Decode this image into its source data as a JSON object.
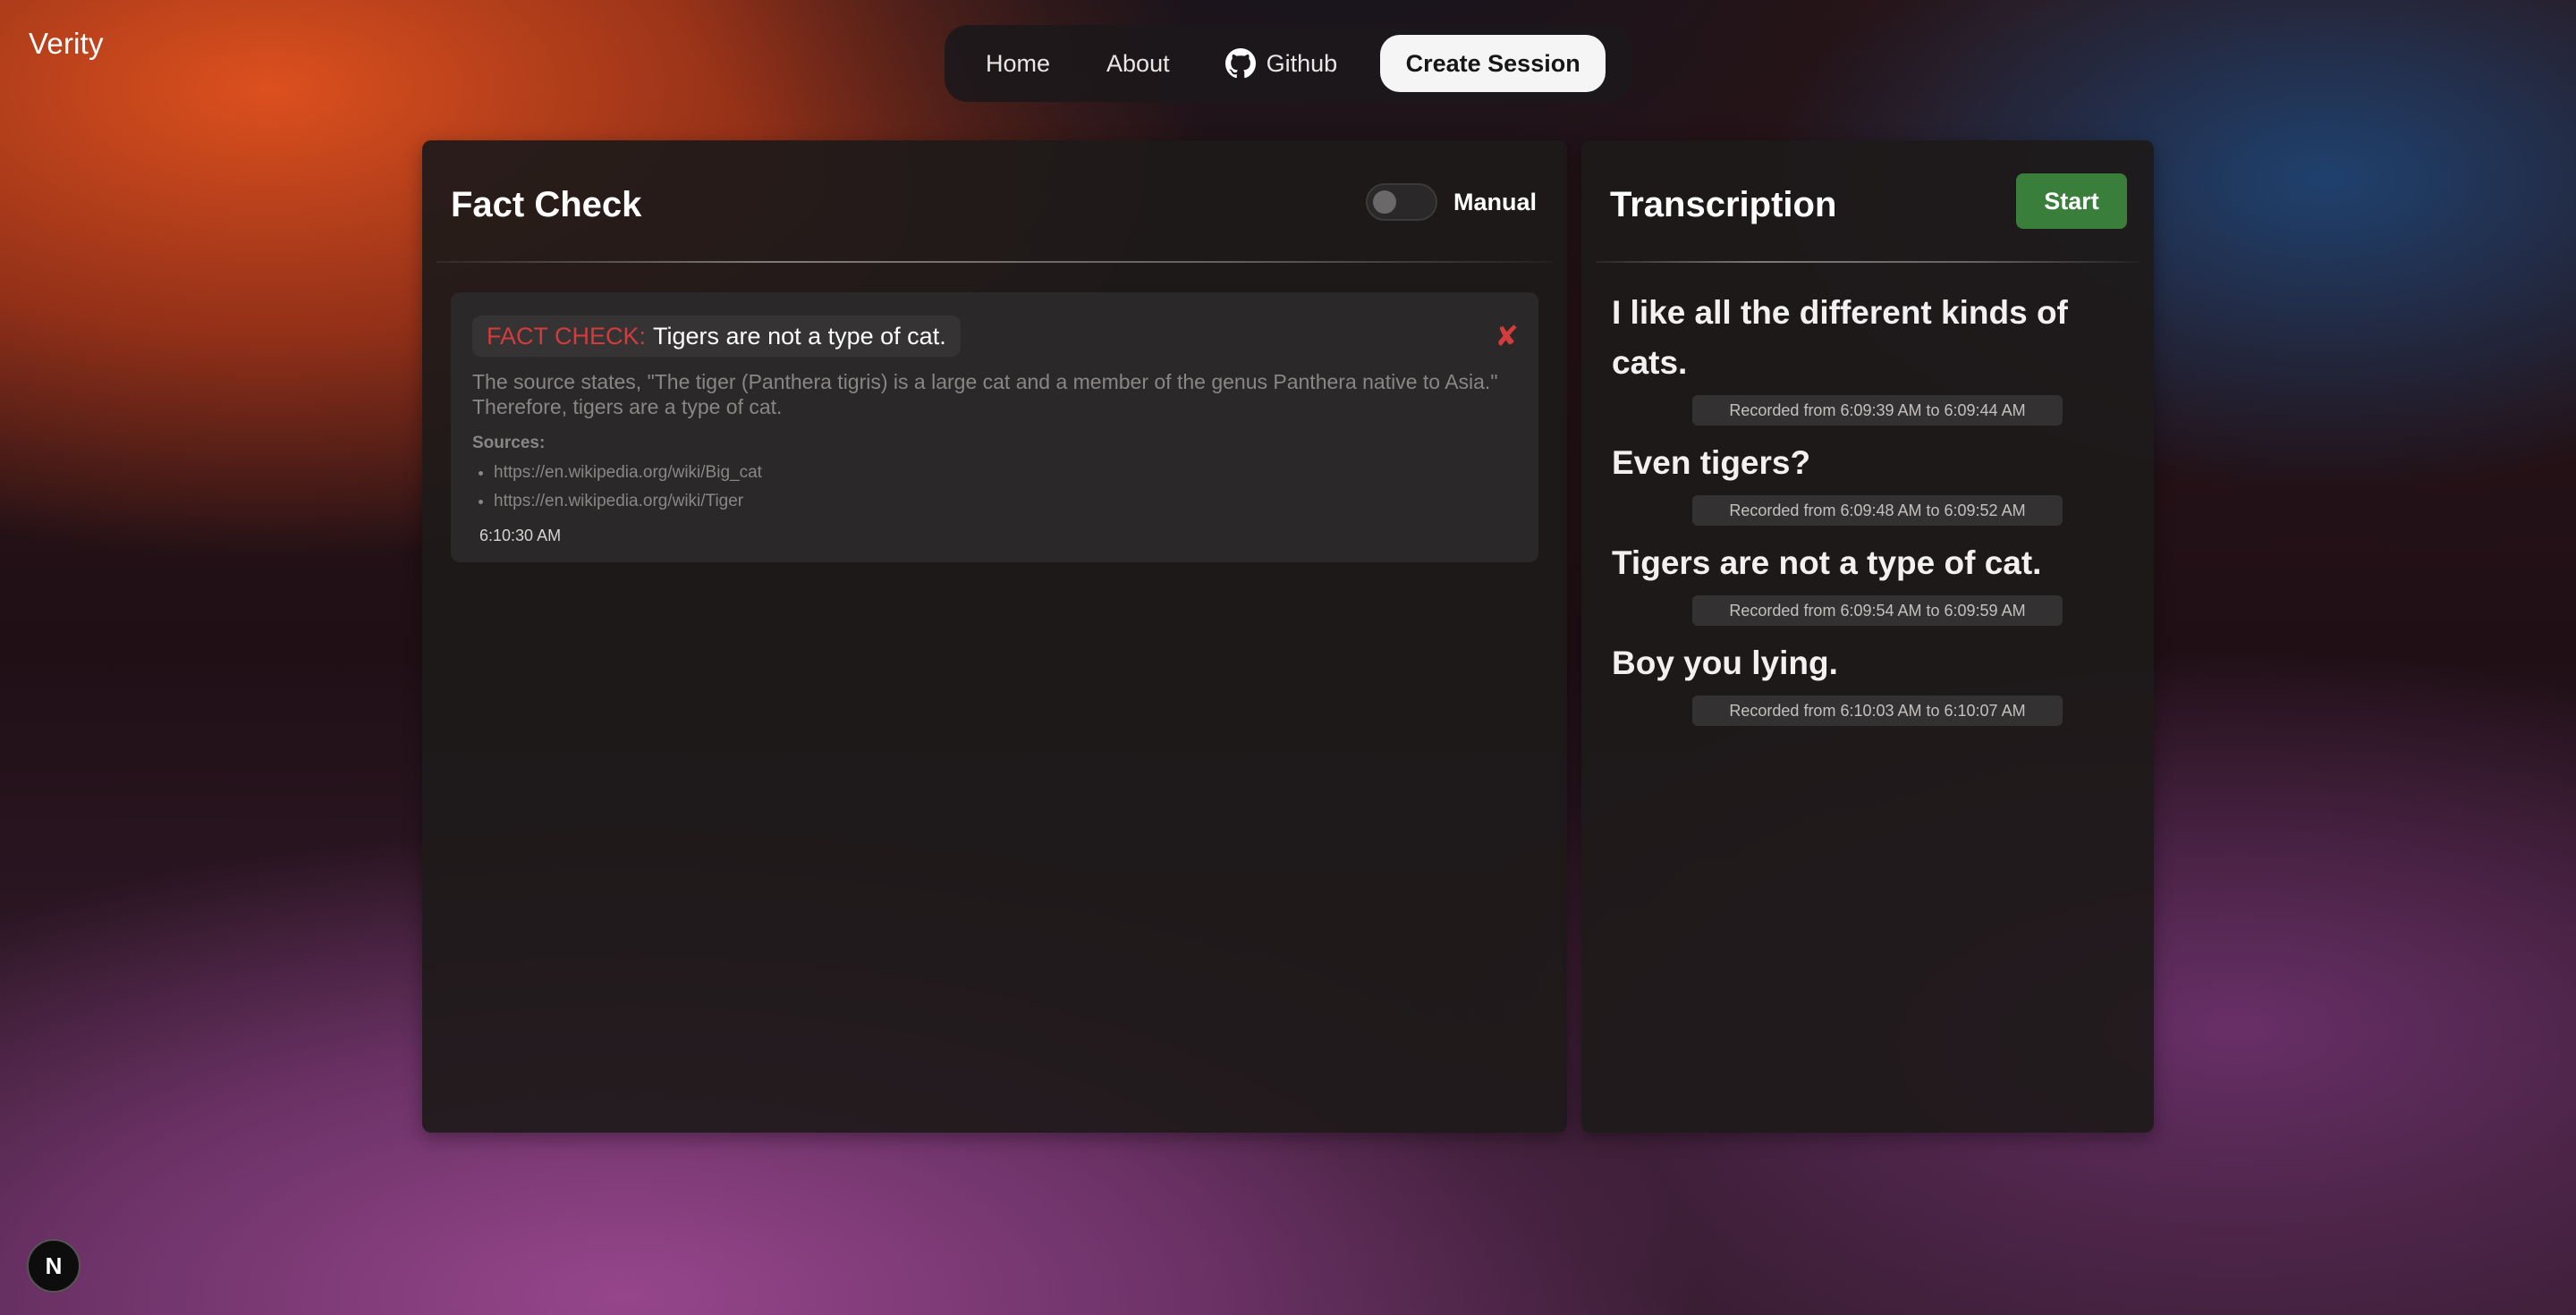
{
  "brand": "Verity",
  "nav": {
    "home": "Home",
    "about": "About",
    "github": "Github",
    "create_session": "Create Session"
  },
  "fact_check": {
    "title": "Fact Check",
    "toggle_label": "Manual",
    "toggle_on": false,
    "cards": [
      {
        "prefix": "FACT CHECK:",
        "claim": "Tigers are not a type of cat.",
        "explanation": "The source states, \"The tiger (Panthera tigris) is a large cat and a member of the genus Panthera native to Asia.\" Therefore, tigers are a type of cat.",
        "sources_label": "Sources:",
        "sources": [
          "https://en.wikipedia.org/wiki/Big_cat",
          "https://en.wikipedia.org/wiki/Tiger"
        ],
        "time": "6:10:30 AM",
        "verdict_icon": "x-mark-icon"
      }
    ]
  },
  "transcription": {
    "title": "Transcription",
    "start_label": "Start",
    "items": [
      {
        "text": "I like all the different kinds of cats.",
        "meta": "Recorded from 6:09:39 AM to 6:09:44 AM"
      },
      {
        "text": "Even tigers?",
        "meta": "Recorded from 6:09:48 AM to 6:09:52 AM"
      },
      {
        "text": "Tigers are not a type of cat.",
        "meta": "Recorded from 6:09:54 AM to 6:09:59 AM"
      },
      {
        "text": "Boy you lying.",
        "meta": "Recorded from 6:10:03 AM to 6:10:07 AM"
      }
    ]
  },
  "badge": "N",
  "colors": {
    "accent_red": "#d23c3c",
    "start_green": "#3a7e3c",
    "panel_bg": "#1e1a1a"
  }
}
